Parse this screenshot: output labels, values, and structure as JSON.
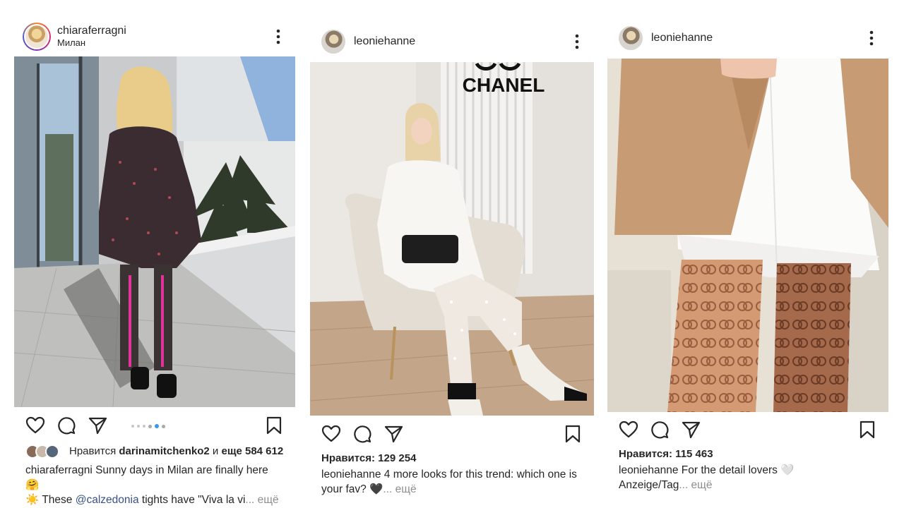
{
  "posts": [
    {
      "username": "chiaraferragni",
      "location": "Милан",
      "likes_prefix": "Нравится",
      "liked_by": "darinamitchenko2",
      "likes_joiner": "и",
      "likes_rest": "еще 584 612",
      "caption_text_1": "Sunny days in Milan are finally here 🤗",
      "caption_text_2": "☀️ These",
      "caption_mention": "@calzedonia",
      "caption_text_3": "tights have \"Viva la vi",
      "caption_more": "... ещё",
      "carousel": {
        "count": 6,
        "active_index": 4
      }
    },
    {
      "username": "leoniehanne",
      "likes_label": "Нравится: 129 254",
      "caption_text": "4 more looks for this trend: which one is your fav? 🖤",
      "caption_more": "... ещё",
      "photo_text": "CHANEL"
    },
    {
      "username": "leoniehanne",
      "likes_label": "Нравится: 115 463",
      "caption_text": "For the detail lovers 🤍",
      "caption_text_2": "Anzeige/Tag",
      "caption_more": "... ещё"
    }
  ],
  "icons": [
    "heart-icon",
    "comment-icon",
    "share-icon",
    "bookmark-icon",
    "more-options-icon"
  ],
  "colors": {
    "link": "#385185",
    "muted": "#8e8e8e",
    "text": "#262626",
    "carousel_active": "#3897f0"
  }
}
